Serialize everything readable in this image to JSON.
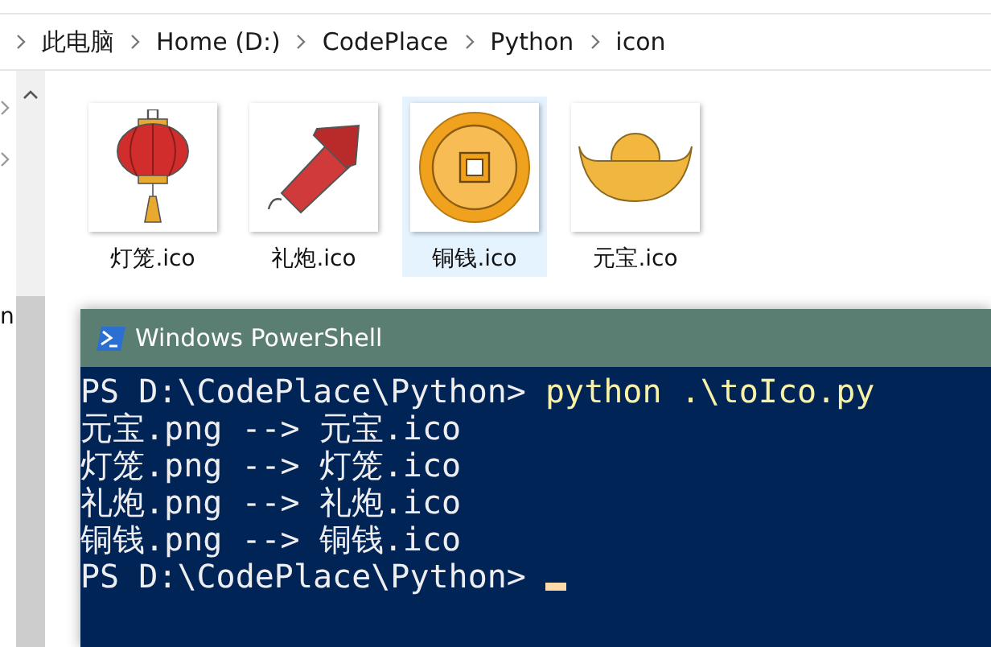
{
  "breadcrumb": [
    {
      "label": "此电脑"
    },
    {
      "label": "Home (D:)"
    },
    {
      "label": "CodePlace"
    },
    {
      "label": "Python"
    },
    {
      "label": "icon"
    }
  ],
  "nav_pane": {
    "items": [
      {
        "label": "n"
      }
    ]
  },
  "files": [
    {
      "name": "灯笼.ico",
      "kind": "lantern",
      "selected": false
    },
    {
      "name": "礼炮.ico",
      "kind": "firecracker",
      "selected": false
    },
    {
      "name": "铜钱.ico",
      "kind": "coin",
      "selected": true
    },
    {
      "name": "元宝.ico",
      "kind": "ingot",
      "selected": false
    }
  ],
  "console": {
    "title": "Windows PowerShell",
    "lines": [
      {
        "segments": [
          {
            "text": "PS D:\\CodePlace\\Python> ",
            "kind": "plain"
          },
          {
            "text": "python .\\toIco.py",
            "kind": "command"
          }
        ],
        "cursor": false
      },
      {
        "segments": [
          {
            "text": "元宝.png --> 元宝.ico",
            "kind": "plain"
          }
        ],
        "cursor": false
      },
      {
        "segments": [
          {
            "text": "灯笼.png --> 灯笼.ico",
            "kind": "plain"
          }
        ],
        "cursor": false
      },
      {
        "segments": [
          {
            "text": "礼炮.png --> 礼炮.ico",
            "kind": "plain"
          }
        ],
        "cursor": false
      },
      {
        "segments": [
          {
            "text": "铜钱.png --> 铜钱.ico",
            "kind": "plain"
          }
        ],
        "cursor": false
      },
      {
        "segments": [
          {
            "text": "PS D:\\CodePlace\\Python> ",
            "kind": "plain"
          }
        ],
        "cursor": true
      }
    ]
  }
}
